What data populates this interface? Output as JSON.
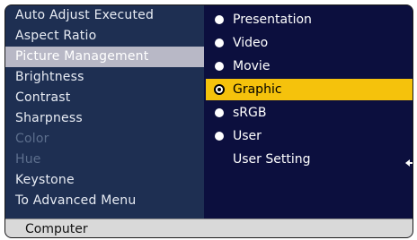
{
  "menu": {
    "items": [
      {
        "label": "Auto Adjust Executed",
        "state": "normal"
      },
      {
        "label": "Aspect Ratio",
        "state": "normal"
      },
      {
        "label": "Picture Management",
        "state": "selected"
      },
      {
        "label": "Brightness",
        "state": "normal"
      },
      {
        "label": "Contrast",
        "state": "normal"
      },
      {
        "label": "Sharpness",
        "state": "normal"
      },
      {
        "label": "Color",
        "state": "disabled"
      },
      {
        "label": "Hue",
        "state": "disabled"
      },
      {
        "label": "Keystone",
        "state": "normal"
      },
      {
        "label": "To Advanced Menu",
        "state": "normal"
      }
    ]
  },
  "picture_management": {
    "options": [
      {
        "label": "Presentation",
        "selected": false
      },
      {
        "label": "Video",
        "selected": false
      },
      {
        "label": "Movie",
        "selected": false
      },
      {
        "label": "Graphic",
        "selected": true
      },
      {
        "label": "sRGB",
        "selected": false
      },
      {
        "label": "User",
        "selected": false
      }
    ],
    "user_setting_label": "User Setting",
    "enter_icon": "enter-return-icon"
  },
  "footer": {
    "source_label": "Computer"
  },
  "colors": {
    "menu_bg": "#1e2f52",
    "panel_bg": "#0c0f3e",
    "selected_menu_bg": "#b8b8c6",
    "selected_option_bg": "#f5c20c",
    "footer_bg": "#d9d9d9"
  }
}
